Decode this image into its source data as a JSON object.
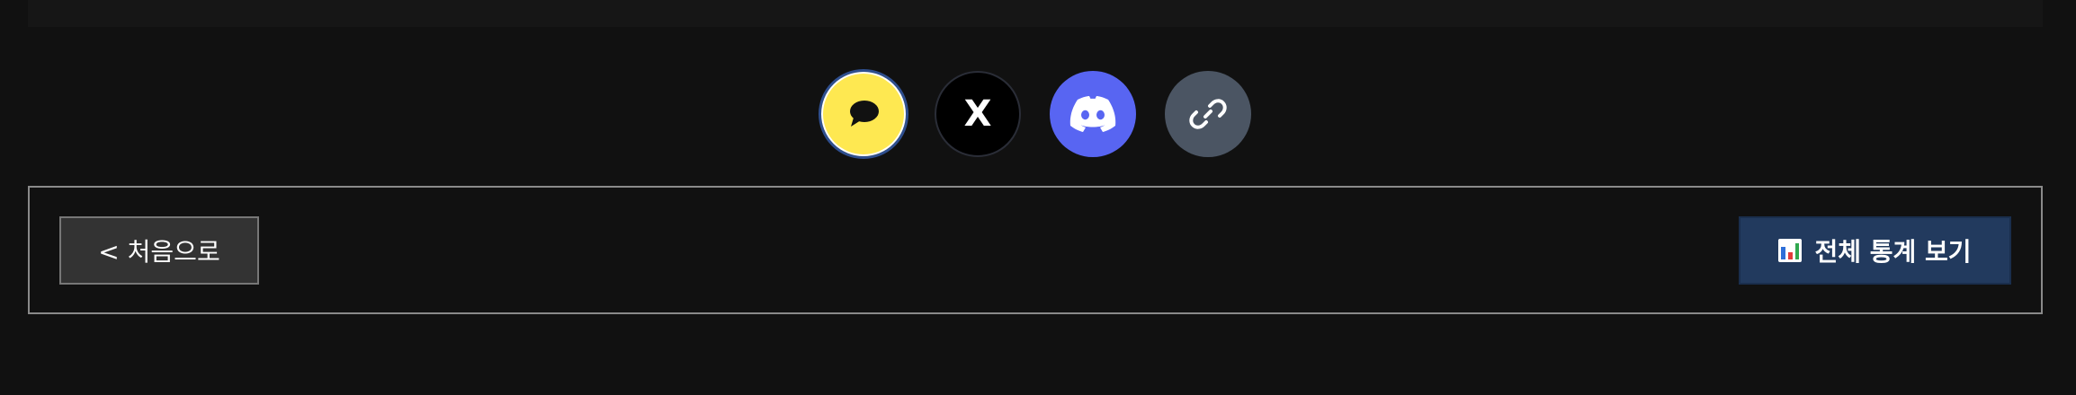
{
  "share": {
    "buttons": [
      {
        "name": "kakaotalk",
        "icon": "speech-bubble-icon",
        "color": "#FEE851"
      },
      {
        "name": "x",
        "icon": "x-logo-icon",
        "glyph": "X",
        "color": "#000000"
      },
      {
        "name": "discord",
        "icon": "discord-icon",
        "color": "#5865F2"
      },
      {
        "name": "copy-link",
        "icon": "link-icon",
        "color": "#4B5563"
      }
    ]
  },
  "navigation": {
    "back_label": "< 처음으로",
    "stats_label": "전체 통계 보기",
    "stats_icon": "bar-chart-icon",
    "stats_button_color": "#223A5E"
  }
}
